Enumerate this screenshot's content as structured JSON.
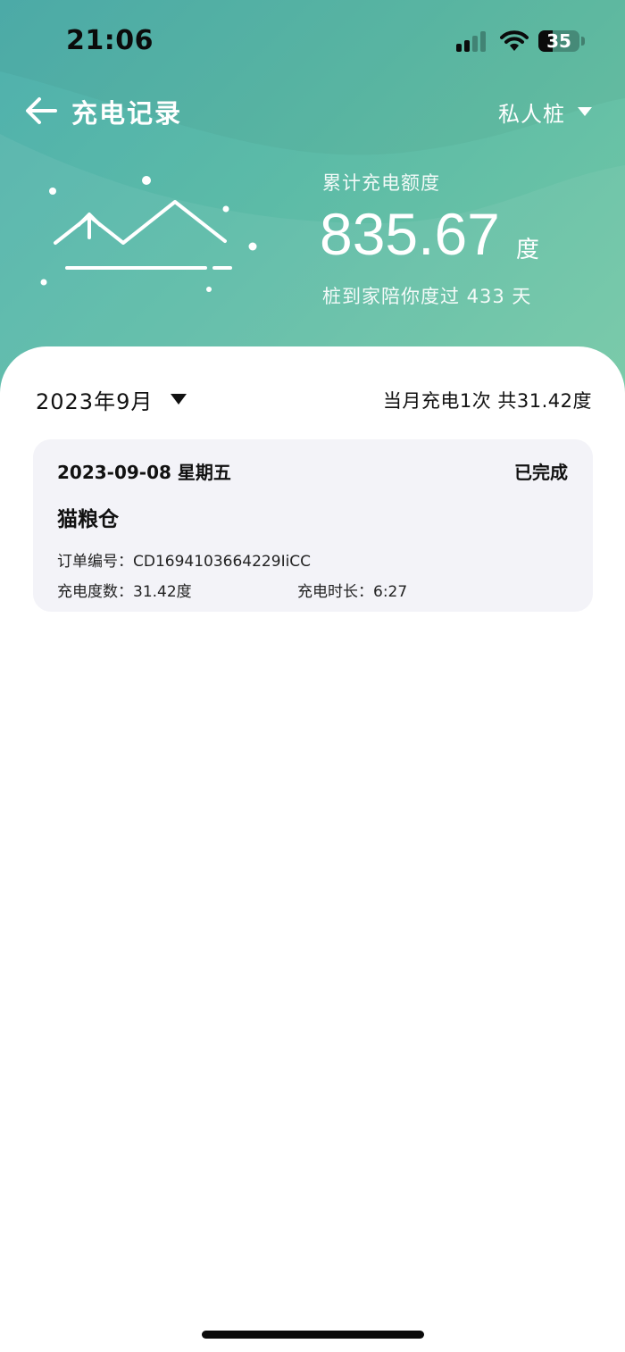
{
  "status_bar": {
    "time": "21:06",
    "battery_level": "35",
    "battery_fraction": 0.35
  },
  "header": {
    "title": "充电记录",
    "pile_selector": "私人桩",
    "total_label": "累计充电额度",
    "total_value": "835.67",
    "total_unit": "度",
    "days_text": "桩到家陪你度过 433 天"
  },
  "month": {
    "label": "2023年9月",
    "summary": "当月充电1次 共31.42度"
  },
  "records": [
    {
      "date": "2023-09-08 星期五",
      "status": "已完成",
      "station": "猫粮仓",
      "order_line": "订单编号：CD1694103664229IiCC",
      "kwh_line": "充电度数：31.42度",
      "duration_line": "充电时长：6:27"
    }
  ],
  "icons": {
    "back": "arrow-left-icon",
    "pile_dropdown": "caret-down-icon",
    "month_dropdown": "caret-down-icon",
    "signal": "cellular-signal-icon",
    "wifi": "wifi-icon",
    "illustration": "energy-chart-illustration"
  },
  "colors": {
    "header_gradient_start": "#4fb0ad",
    "header_gradient_end": "#74c8a4",
    "card_background": "#f3f3f8"
  }
}
